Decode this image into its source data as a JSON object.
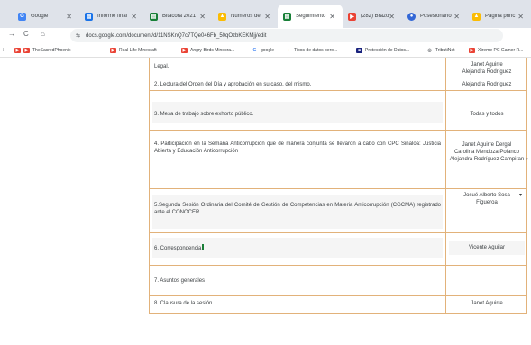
{
  "tabs": [
    {
      "label": "Google",
      "icon": "google-icon",
      "color": "#4285f4",
      "glyph": "G"
    },
    {
      "label": "Informe final",
      "icon": "sheets-icon",
      "color": "#1a73e8",
      "glyph": "▤"
    },
    {
      "label": "Bitácora 2021",
      "icon": "sheets-icon",
      "color": "#188038",
      "glyph": "▤"
    },
    {
      "label": "Numeros de",
      "icon": "drive-icon",
      "color": "#fbbc04",
      "glyph": "▲"
    },
    {
      "label": "Seguimiento",
      "icon": "sheets-icon",
      "color": "#188038",
      "glyph": "▤"
    },
    {
      "label": "(282) Brazo",
      "icon": "youtube-icon",
      "color": "#ea4335",
      "glyph": "▶"
    },
    {
      "label": "Posesionario",
      "icon": "app-icon",
      "color": "#3367d6",
      "glyph": "●"
    },
    {
      "label": "Página princ",
      "icon": "drive-icon",
      "color": "#fbbc04",
      "glyph": "▲"
    }
  ],
  "address": {
    "url": "docs.google.com/document/d/11NSKnQ7c7TQe046Fb_50qOzbKEKMjj/edit"
  },
  "bookmarks": [
    {
      "label": "TheSacredPhoenix",
      "color": "#ea4335",
      "glyph": "▶"
    },
    {
      "label": "Real Life Minecraft",
      "color": "#ea4335",
      "glyph": "▶"
    },
    {
      "label": "Angry Birds Minecra...",
      "color": "#ea4335",
      "glyph": "▶"
    },
    {
      "label": "google",
      "color": "#4285f4",
      "glyph": "G"
    },
    {
      "label": "Tipos de datos pero...",
      "color": "#f9ab00",
      "glyph": "◖"
    },
    {
      "label": "Protección de Datos...",
      "color": "#1a237e",
      "glyph": "■"
    },
    {
      "label": "TributiNet",
      "color": "#5f6368",
      "glyph": "◎"
    },
    {
      "label": "Xtreme PC Gamer R...",
      "color": "#ea4335",
      "glyph": "▶"
    }
  ],
  "document": {
    "rows": [
      {
        "item": "Legal.",
        "responsible": "Janet Aguirre\nAlejandra Rodríguez"
      },
      {
        "item": "2. Lectura del Orden del Día y aprobación en su caso, del mismo.",
        "responsible": "Alejandra Rodríguez"
      },
      {
        "item": "3. Mesa de trabajo sobre exhorto público.",
        "responsible": "Todas y todos"
      },
      {
        "item": "4.  Participación en la Semana Anticorrupción que de manera conjunta se llevaron a cabo con CPC Sinaloa: Justicia Abierta y Educación Anticorrupción",
        "responsible": "Janet Aguirre Dergal\nCarolina Mendoza Polanco\nAlejandra Rodríguez Campiran"
      },
      {
        "item": "5.Segunda Sesión Ordinaria del Comité de Gestión de Competencias en Materia Anticorrupción (CGCMA) registrado ante el CONOCER.",
        "responsible": "Josué Alberto Sosa\nFigueroa"
      },
      {
        "item": "6. Correspondencia",
        "responsible": "Vicente Aguilar"
      },
      {
        "item": "7. Asuntos generales",
        "responsible": ""
      },
      {
        "item": "8. Clausura de la sesión.",
        "responsible": "Janet Aguirre"
      }
    ]
  }
}
